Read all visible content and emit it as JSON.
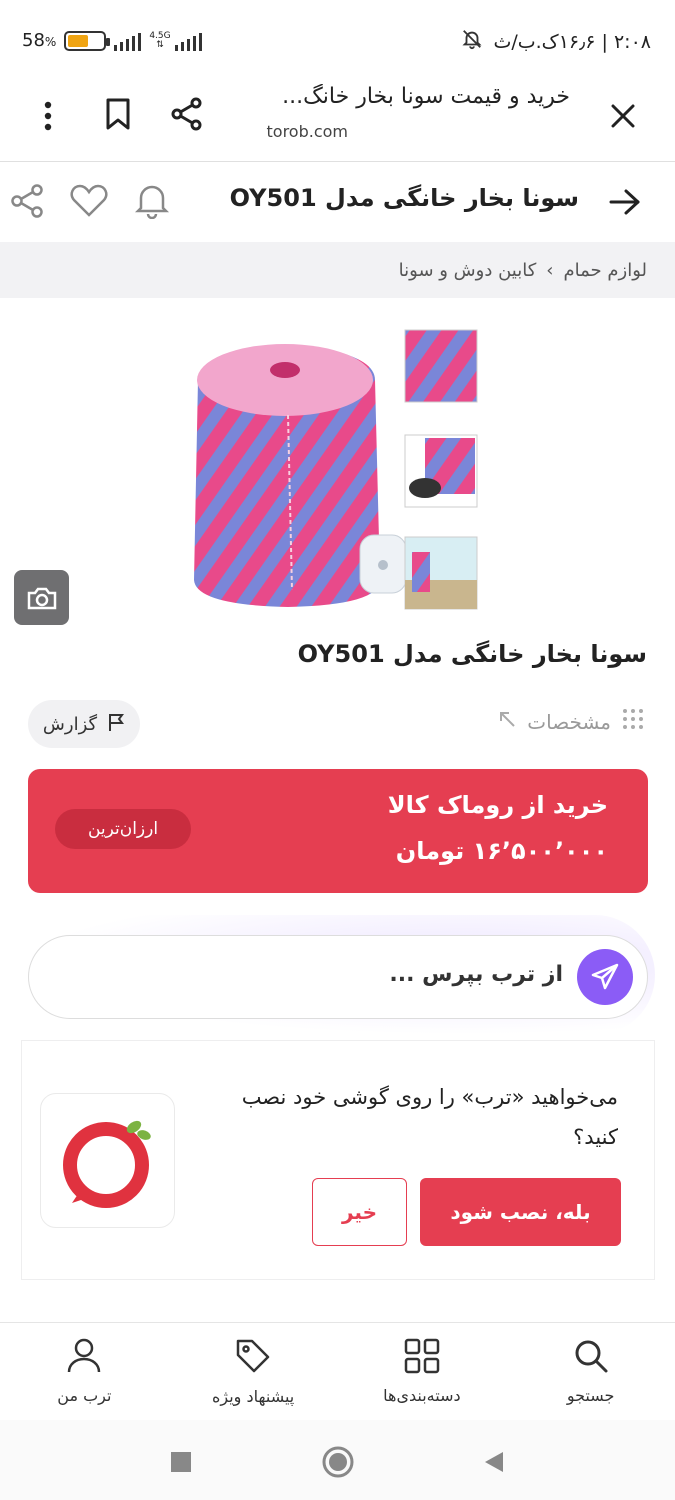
{
  "status_bar": {
    "battery_percent": "58",
    "battery_symbol": "%",
    "battery_level": 0.58,
    "network": "4.5G",
    "time_info": "۲:۰۸ | ۱۶٫۶ک.ب/ث"
  },
  "browser": {
    "page_title": "خرید و قیمت سونا بخار خانگ...",
    "url": "torob.com"
  },
  "product_header": {
    "title": "سونا بخار خانگی مدل OY501"
  },
  "breadcrumb": {
    "items": [
      "لوازم حمام",
      "کابین دوش و سونا"
    ],
    "separator": "›"
  },
  "product": {
    "title": "سونا بخار خانگی مدل OY501",
    "specs_label": "مشخصات",
    "report_label": "گزارش"
  },
  "offer": {
    "store": "خرید از روماک کالا",
    "price": "۱۶٬۵۰۰٬۰۰۰ تومان",
    "badge": "ارزان‌ترین"
  },
  "ask": {
    "placeholder": "از ترب بپرس ..."
  },
  "install_prompt": {
    "question": "می‌خواهید «ترب» را روی گوشی خود نصب کنید؟",
    "yes_label": "بله، نصب شود",
    "no_label": "خیر"
  },
  "bottom_nav": {
    "items": [
      {
        "label": "جستجو",
        "icon": "search-icon"
      },
      {
        "label": "دسته‌بندی‌ها",
        "icon": "grid-icon"
      },
      {
        "label": "پیشنهاد ویژه",
        "icon": "tag-icon"
      },
      {
        "label": "ترب من",
        "icon": "user-icon"
      }
    ]
  },
  "colors": {
    "accent": "#e53e51",
    "send_button": "#8b5cf6"
  }
}
